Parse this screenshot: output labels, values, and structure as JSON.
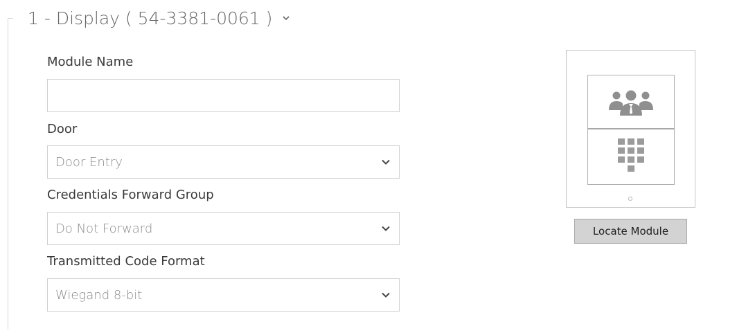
{
  "section": {
    "title": "1 - Display ( 54-3381-0061 )",
    "toggle_icon": "chevron-down-icon"
  },
  "form": {
    "module_name": {
      "label": "Module Name",
      "value": "",
      "placeholder": ""
    },
    "door": {
      "label": "Door",
      "selected": "Door Entry"
    },
    "credentials_forward_group": {
      "label": "Credentials Forward Group",
      "selected": "Do Not Forward"
    },
    "transmitted_code_format": {
      "label": "Transmitted Code Format",
      "selected": "Wiegand 8-bit"
    }
  },
  "module_preview": {
    "top_icon": "users-icon",
    "bottom_icon": "keypad-icon",
    "locate_button_label": "Locate Module"
  },
  "colors": {
    "text": "#333333",
    "muted_text": "#8a8a8a",
    "border": "#cfcfcf",
    "button_bg": "#d3d3d3",
    "icon_gray": "#8f8f8f"
  }
}
